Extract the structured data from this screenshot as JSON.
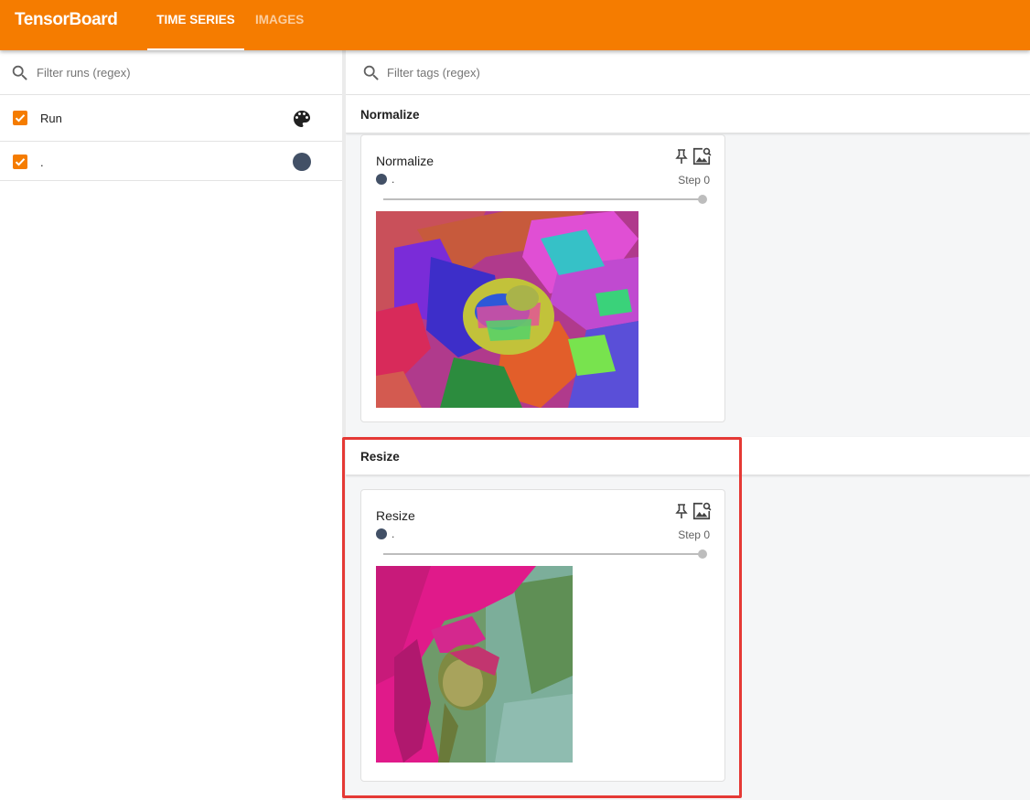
{
  "app": {
    "title": "TensorBoard"
  },
  "tabs": [
    {
      "label": "TIME SERIES",
      "active": true
    },
    {
      "label": "IMAGES",
      "active": false
    }
  ],
  "sidebar": {
    "filter_placeholder": "Filter runs (regex)",
    "runs": [
      {
        "label": "Run",
        "checked": true,
        "icon": "palette-icon"
      },
      {
        "label": ".",
        "checked": true,
        "color": "#425066"
      }
    ]
  },
  "main": {
    "tag_filter_placeholder": "Filter tags (regex)",
    "groups": [
      {
        "header": "Normalize",
        "card": {
          "title": "Normalize",
          "run": ".",
          "step": "Step 0",
          "image": "normalized flower bud (false color)"
        }
      },
      {
        "header": "Resize",
        "card": {
          "title": "Resize",
          "run": ".",
          "step": "Step 0",
          "image": "resized flower bud"
        }
      }
    ]
  },
  "colors": {
    "brand": "#f57c00",
    "run_color": "#425066",
    "highlight": "#e53935"
  }
}
